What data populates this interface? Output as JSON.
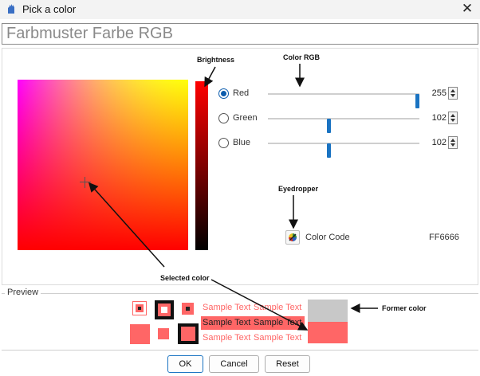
{
  "window": {
    "title": "Pick a color"
  },
  "name_field": {
    "value": "Farbmuster Farbe RGB"
  },
  "channels": [
    {
      "label": "Red",
      "value": "255",
      "level": 1.0,
      "selected": true
    },
    {
      "label": "Green",
      "value": "102",
      "level": 0.4,
      "selected": false
    },
    {
      "label": "Blue",
      "value": "102",
      "level": 0.4,
      "selected": false
    }
  ],
  "color_code": {
    "label": "Color Code",
    "value": "FF6666"
  },
  "annotations": {
    "brightness": "Brightness",
    "color_rgb": "Color RGB",
    "eyedropper": "Eyedropper",
    "selected_color": "Selected color",
    "former_color": "Former color"
  },
  "preview": {
    "label": "Preview",
    "sample_text": "Sample Text",
    "new_color": "#ff6666",
    "former_color": "#c8c8c8"
  },
  "buttons": {
    "ok": "OK",
    "cancel": "Cancel",
    "reset": "Reset"
  },
  "icons": [
    "app-icon",
    "close-icon",
    "crosshair-icon",
    "eyedropper-icon",
    "spin-up-icon",
    "spin-down-icon"
  ]
}
